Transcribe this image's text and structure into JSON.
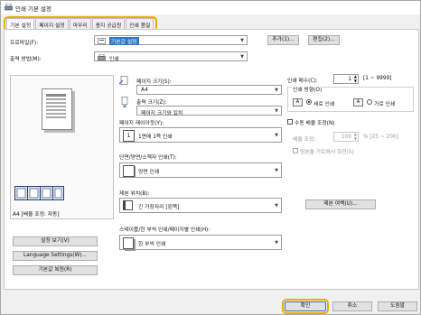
{
  "window": {
    "title": "인쇄 기본 설정"
  },
  "tabs": [
    {
      "label": "기본 설정"
    },
    {
      "label": "페이지 설정"
    },
    {
      "label": "마무리"
    },
    {
      "label": "용지 공급원"
    },
    {
      "label": "인쇄 품질"
    }
  ],
  "profile": {
    "label": "프로파일(F):",
    "value": "기본값 설정",
    "add_label": "추가(1)...",
    "edit_label": "편집(2)..."
  },
  "output": {
    "label": "출력 방법(M):",
    "value": "인쇄"
  },
  "preview": {
    "caption": "A4 [배율 조정: 자동]"
  },
  "page_size": {
    "label": "페이지 크기(S):",
    "value": "A4"
  },
  "output_size": {
    "label": "출력 크기(Z):",
    "value": "페이지 크기와 일치"
  },
  "copies": {
    "label": "인쇄 매수(C):",
    "value": "1",
    "range": "[1 ~ 9999]"
  },
  "orientation": {
    "label": "인쇄 방향(O)",
    "portrait": "세로 인쇄",
    "landscape": "가로 인쇄"
  },
  "layout": {
    "label": "페이지 레이아웃(Y):",
    "value": "1면에 1쪽 인쇄"
  },
  "manual_scale": {
    "label": "수동 배율 조정(N)",
    "scale_label": "배율 조정:",
    "scale_value": "100",
    "scale_range": "% [25 ~ 200]",
    "rotate_label": "원본을 가로에서 회전(5)"
  },
  "duplex": {
    "label": "단면/양면/소책자 인쇄(T):",
    "value": "양면 인쇄"
  },
  "binding": {
    "label": "제본 위치(B):",
    "value": "긴 가장자리 [왼쪽]",
    "button_label": "제본 여백(U)..."
  },
  "collate": {
    "label": "스테이플/한 부씩 인쇄/페이지별 인쇄(H):",
    "value": "한 부씩 인쇄"
  },
  "left_buttons": {
    "view_settings": "설정 보기(V)",
    "language": "Language Settings(W)...",
    "restore": "기본값 복원(R)"
  },
  "footer": {
    "ok": "확인",
    "cancel": "취소",
    "help": "도움말"
  },
  "colors": {
    "accent": "#f2a900",
    "selection": "#3178c6"
  }
}
